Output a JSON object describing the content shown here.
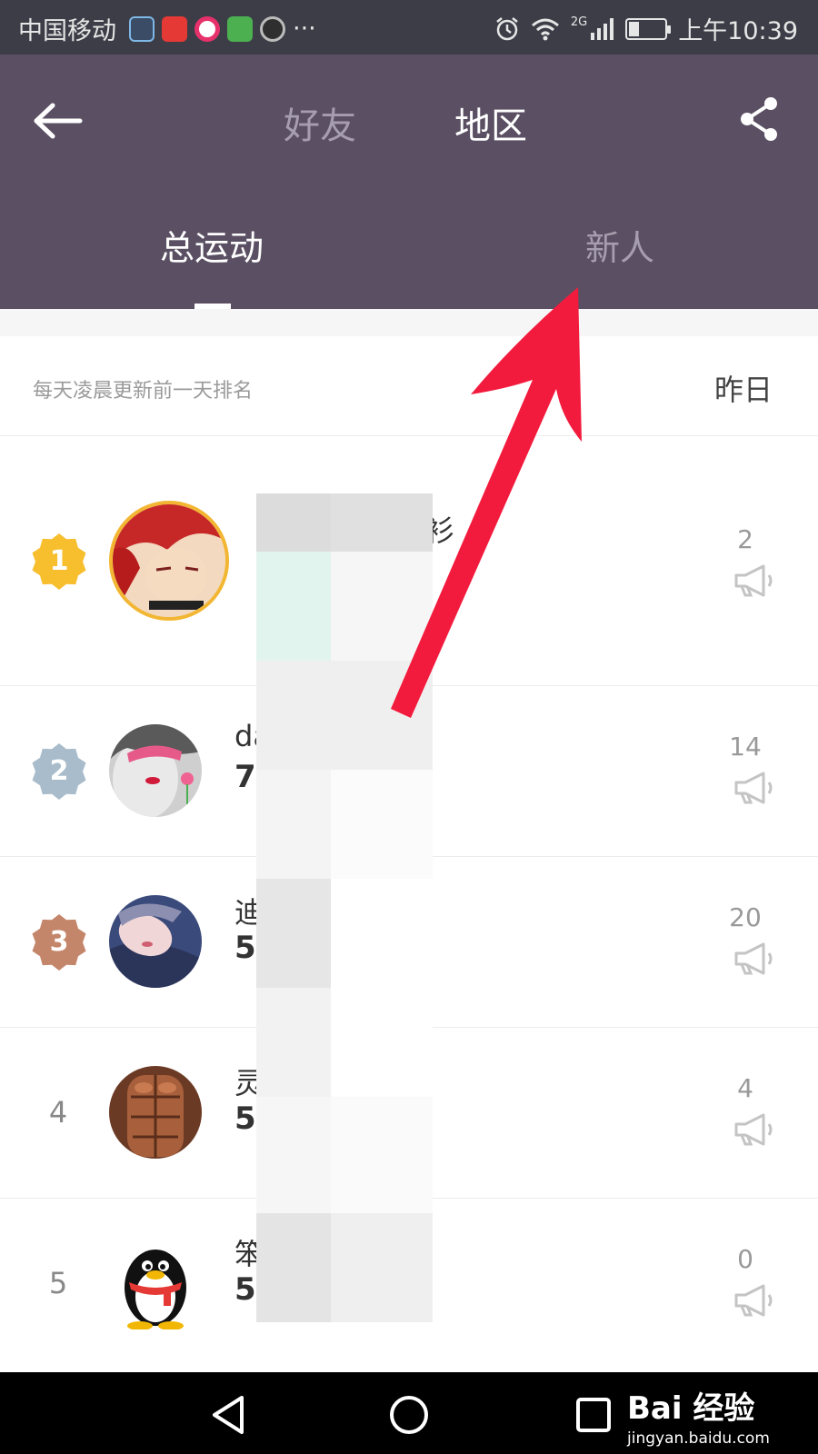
{
  "status_bar": {
    "carrier": "中国移动",
    "network": "2G",
    "time": "上午10:39",
    "battery_level": 0.3,
    "more": "···"
  },
  "header": {
    "tabs": [
      "好友",
      "地区"
    ],
    "selected_tab": "地区",
    "sub_tabs": [
      "总运动",
      "新人"
    ],
    "selected_sub_tab": "总运动",
    "icons": {
      "back": "back-arrow-icon",
      "share": "share-icon"
    }
  },
  "list_header": {
    "note": "每天凌晨更新前一天排名",
    "date_filter": "昨日"
  },
  "rankings": [
    {
      "rank": "1",
      "name": "人衫",
      "score": "",
      "likes": "2",
      "badge_color": "#f7be2e"
    },
    {
      "rank": "2",
      "name": "da",
      "score": "77",
      "likes": "14",
      "badge_color": "#a9bccb"
    },
    {
      "rank": "3",
      "name": "迪",
      "score": "57",
      "likes": "20",
      "badge_color": "#c4866a"
    },
    {
      "rank": "4",
      "name": "灵",
      "score": "53",
      "likes": "4"
    },
    {
      "rank": "5",
      "name": "笨",
      "score": "52",
      "likes": "0"
    }
  ],
  "colors": {
    "header_bg": "#5b5063",
    "status_bg": "#3d3d48",
    "annotation_arrow": "#f31b3d"
  },
  "watermark": {
    "logo": "Bai 经验",
    "url": "jingyan.baidu.com"
  }
}
